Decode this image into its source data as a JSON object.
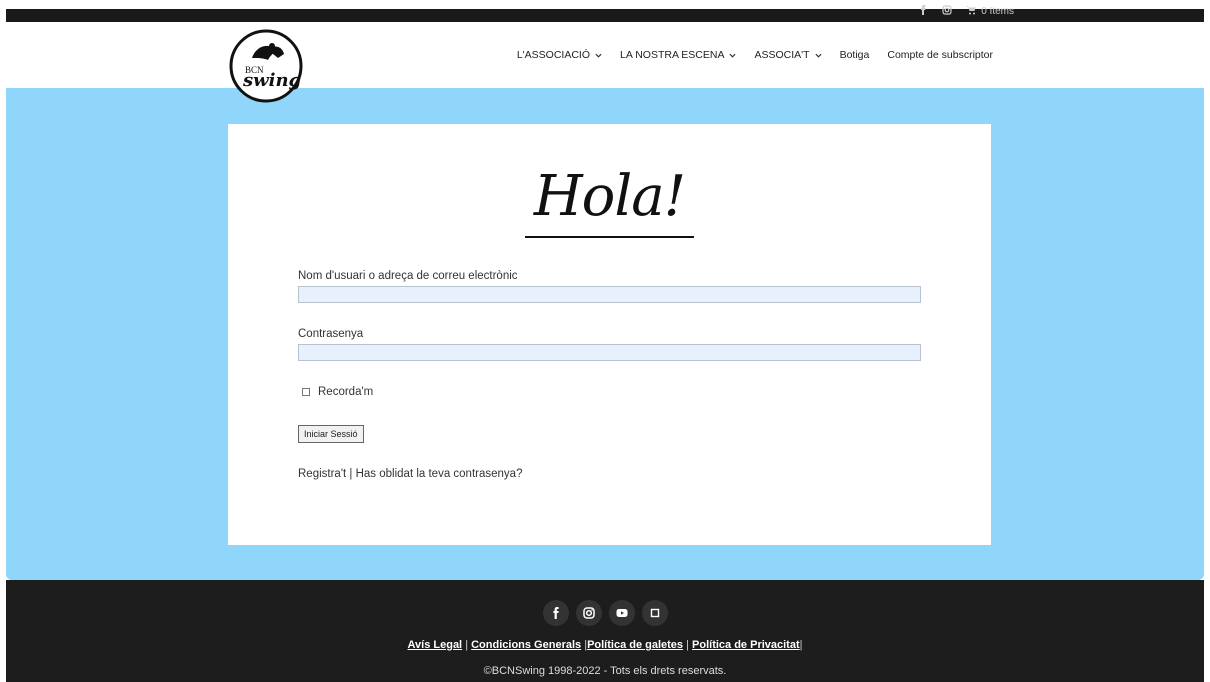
{
  "top_bar": {
    "icons": [
      "facebook-icon",
      "instagram-icon"
    ],
    "cart_label": "0 Items"
  },
  "header": {
    "logo_text_small": "BCN",
    "logo_text_big": "swing",
    "nav": [
      {
        "label": "L'ASSOCIACIÓ",
        "has_dropdown": true
      },
      {
        "label": "LA NOSTRA ESCENA",
        "has_dropdown": true
      },
      {
        "label": "ASSOCIA'T",
        "has_dropdown": true
      },
      {
        "label": "Botiga",
        "has_dropdown": false
      },
      {
        "label": "Compte de subscriptor",
        "has_dropdown": false
      }
    ]
  },
  "login": {
    "title": "Hola!",
    "username_label": "Nom d'usuari o adreça de correu electrònic",
    "username_value": "",
    "password_label": "Contrasenya",
    "password_value": "",
    "remember_label": "Recorda'm",
    "remember_checked": false,
    "submit_label": "Iniciar Sessió",
    "register_link": "Registra't",
    "links_separator": " | ",
    "forgot_link": "Has oblidat la teva contrasenya?"
  },
  "footer": {
    "social": [
      "facebook-icon",
      "instagram-icon",
      "youtube-icon",
      "square-icon"
    ],
    "legal_links": [
      "Avís Legal",
      "Condicions Generals",
      "Política de galetes",
      "Política de Privacitat"
    ],
    "copyright": "©BCNSwing 1998-2022 - Tots els drets reservats."
  },
  "colors": {
    "hero_bg": "#8fd6fa",
    "footer_bg": "#1d1d1d",
    "input_bg": "#e8f0fe"
  }
}
